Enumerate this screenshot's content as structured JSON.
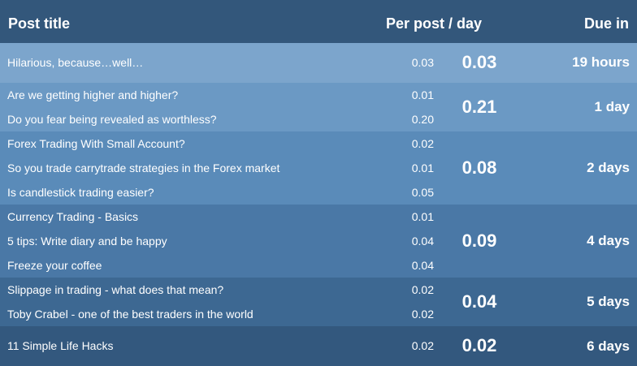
{
  "header": {
    "title": "Post title",
    "per": "Per post / day",
    "due": "Due in"
  },
  "groups": [
    {
      "sum": "0.03",
      "due": "19 hours",
      "posts": [
        {
          "title": "Hilarious, because…well…",
          "per": "0.03"
        }
      ]
    },
    {
      "sum": "0.21",
      "due": "1 day",
      "posts": [
        {
          "title": "Are we getting higher and higher?",
          "per": "0.01"
        },
        {
          "title": "Do you fear being revealed as worthless?",
          "per": "0.20"
        }
      ]
    },
    {
      "sum": "0.08",
      "due": "2 days",
      "posts": [
        {
          "title": "Forex Trading With Small Account?",
          "per": "0.02"
        },
        {
          "title": "So you trade carrytrade strategies in the Forex market",
          "per": "0.01"
        },
        {
          "title": "Is candlestick trading easier?",
          "per": "0.05"
        }
      ]
    },
    {
      "sum": "0.09",
      "due": "4 days",
      "posts": [
        {
          "title": "Currency Trading - Basics",
          "per": "0.01"
        },
        {
          "title": "5 tips: Write diary and be happy",
          "per": "0.04"
        },
        {
          "title": "Freeze your coffee",
          "per": "0.04"
        }
      ]
    },
    {
      "sum": "0.04",
      "due": "5 days",
      "posts": [
        {
          "title": "Slippage in trading - what does that mean?",
          "per": "0.02"
        },
        {
          "title": "Toby Crabel - one of the best traders in the world",
          "per": "0.02"
        }
      ]
    },
    {
      "sum": "0.02",
      "due": "6 days",
      "posts": [
        {
          "title": "11 Simple Life Hacks",
          "per": "0.02"
        }
      ]
    }
  ]
}
